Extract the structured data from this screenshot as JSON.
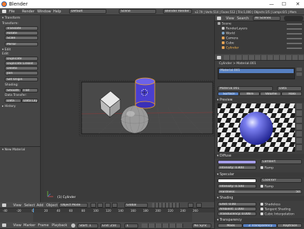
{
  "window": {
    "title": "Blender",
    "minimize": "—",
    "maximize": "☐",
    "close": "✕"
  },
  "menubar": {
    "items": [
      "File",
      "Render",
      "Window",
      "Help"
    ],
    "layout": "Default",
    "scene": "Scene",
    "engine": "Blender Render",
    "stats": "v2.79 | Verts:514 | Faces:512 | Tris:1,000 | Objects:1/5 | Lamps:0/1 | Mem"
  },
  "toolshelf": {
    "transform_header": "Transform",
    "transform_buttons": [
      "Translate",
      "Rotate",
      "Scale"
    ],
    "mirror": "Mirror",
    "edit_header": "Edit",
    "edit_buttons": [
      "Duplicate",
      "Duplicate Linked",
      "Delete",
      "Join"
    ],
    "set_origin": "Set Origin",
    "shading_label": "Shading:",
    "smooth": "Smooth",
    "flat": "Flat",
    "data_transfer_label": "Data Transfer:",
    "data": "Data",
    "data_layout": "Data Layo",
    "history_header": "History",
    "new_material_header": "New Material"
  },
  "viewport": {
    "camera_label": "Camera Persp",
    "object_label": "(1) Cylinder",
    "header": {
      "menus": [
        "View",
        "Select",
        "Add",
        "Object"
      ],
      "mode": "Object Mode",
      "pivot": "Global"
    }
  },
  "timeline": {
    "ruler": [
      "-40",
      "-20",
      "0",
      "20",
      "40",
      "60",
      "80",
      "100",
      "120",
      "140",
      "160",
      "180",
      "200",
      "220",
      "240",
      "260"
    ],
    "menus": [
      "View",
      "Marker",
      "Frame",
      "Playback"
    ],
    "start": "Start:",
    "start_value": "1",
    "end": "End:",
    "end_value": "250",
    "current": "1",
    "sync": "No Sync"
  },
  "outliner": {
    "menus": [
      "View",
      "Search"
    ],
    "filter": "All Scenes",
    "items": [
      "Scene",
      "RenderLayers",
      "World",
      "Camera",
      "Cube",
      "Cylinder"
    ]
  },
  "properties": {
    "breadcrumb": [
      "Cylinder",
      "Material.001"
    ],
    "slot": "Material.001",
    "material_name": "Material.001",
    "link": "Data",
    "tabs": [
      "Surface",
      "Wire",
      "Volume",
      "Halo"
    ],
    "preview_header": "Preview",
    "diffuse_header": "Diffuse",
    "diffuse_shader": "Lambert",
    "intensity_label": "Intensity:",
    "diffuse_intensity": "0.800",
    "ramp": "Ramp",
    "specular_header": "Specular",
    "specular_shader": "CookTorr",
    "specular_intensity": "0.500",
    "hardness_label": "Hardness:",
    "hardness": "50",
    "shading_header": "Shading",
    "emit_label": "Emit:",
    "emit": "0.00",
    "ambient_label": "Ambient:",
    "ambient": "1.000",
    "translucency_label": "Translucency:",
    "translucency": "0.000",
    "shadeless": "Shadeless",
    "tangent": "Tangent Shading",
    "cubic": "Cubic Interpolation",
    "transparency_header": "Transparency",
    "bottom_tabs": [
      "Mask",
      "Z Transparency",
      "Raytrace"
    ],
    "diffuse_color": "#a59de9",
    "specular_color": "#ffffff"
  }
}
